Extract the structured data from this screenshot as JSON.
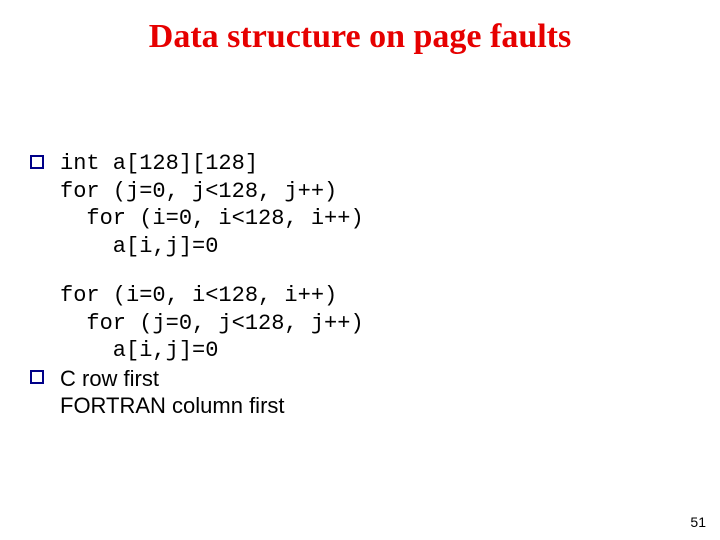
{
  "title": "Data structure on page faults",
  "page_number": "51",
  "blocks": {
    "code1": {
      "line1": "int a[128][128]",
      "line2": "for (j=0, j<128, j++)",
      "line3": "  for (i=0, i<128, i++)",
      "line4": "    a[i,j]=0"
    },
    "code2": {
      "line1": "for (i=0, i<128, i++)",
      "line2": "  for (j=0, j<128, j++)",
      "line3": "    a[i,j]=0"
    },
    "note": {
      "line1": "C row first",
      "line2": "FORTRAN column first"
    }
  }
}
